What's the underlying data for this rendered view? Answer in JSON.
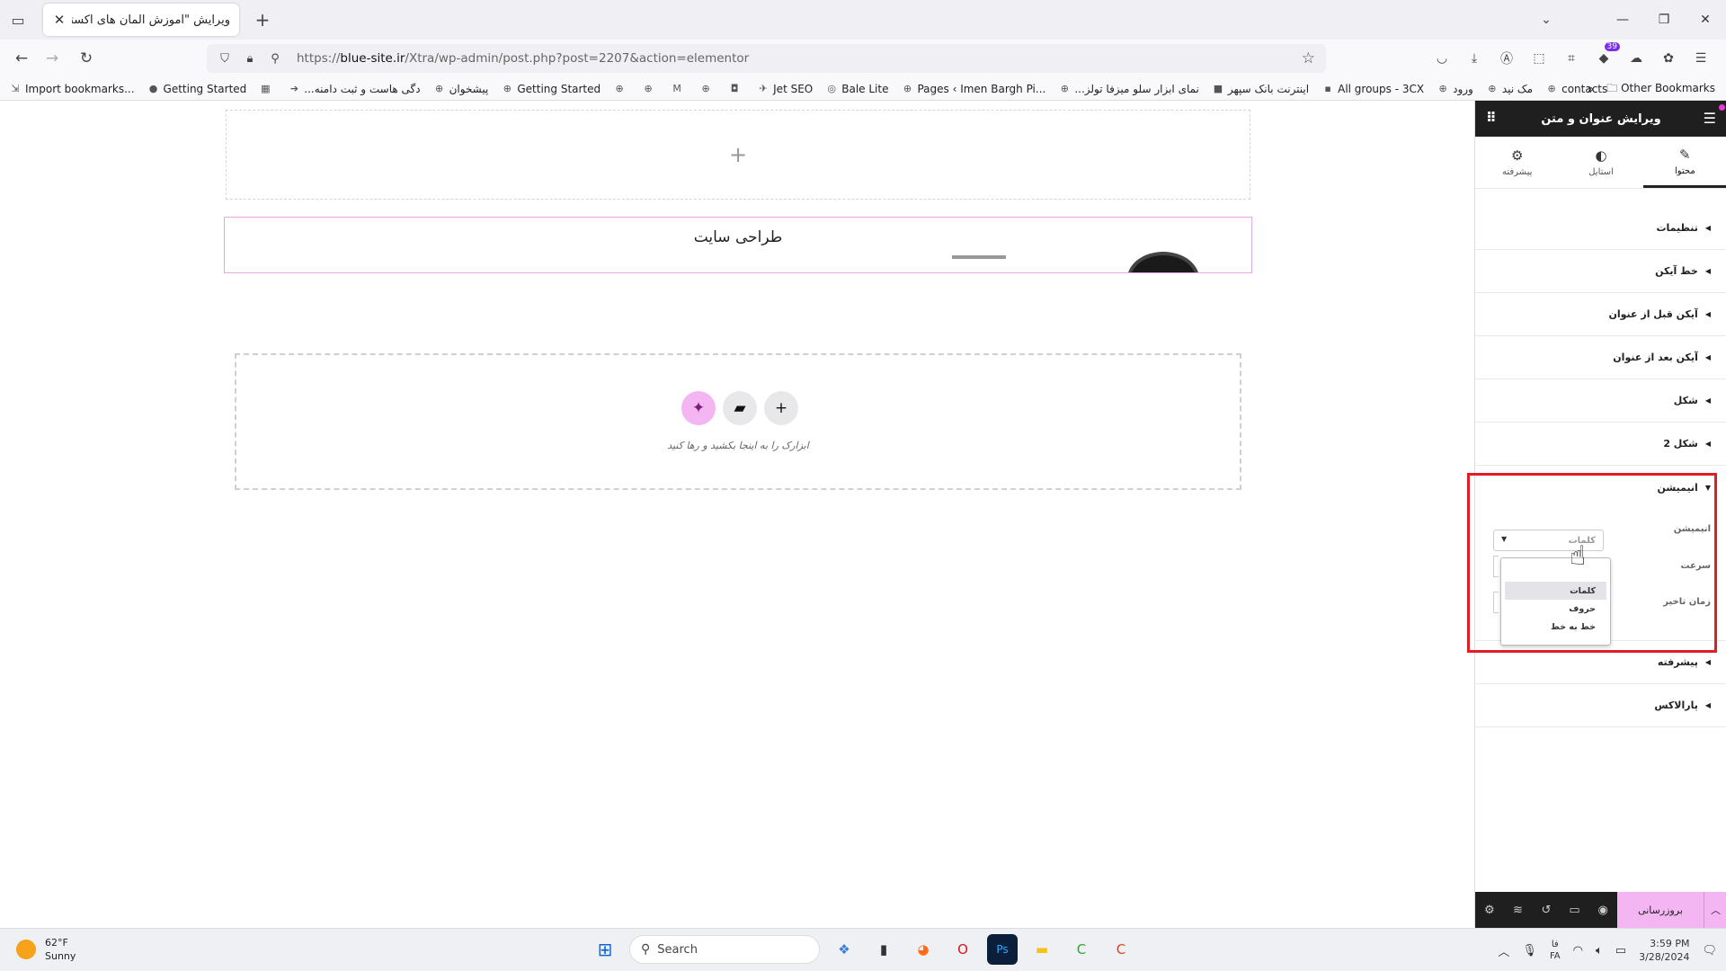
{
  "browser": {
    "tab_title": "ویرایش \"آموزش المان های اکسترا – ت",
    "url_prefix": "https://",
    "url_domain": "blue-site.ir",
    "url_path": "/Xtra/wp-admin/post.php?post=2207&action=elementor",
    "extensions_badge": "39"
  },
  "bookmarks": {
    "items": [
      {
        "label": "Import bookmarks...",
        "icon": "import-icon"
      },
      {
        "label": "Getting Started",
        "icon": "firefox-icon"
      },
      {
        "label": "",
        "icon": "calendar-icon"
      },
      {
        "label": "...دگی هاست و ثبت دامنه",
        "icon": "arrow-icon"
      },
      {
        "label": "پیشخوان",
        "icon": "globe-icon"
      },
      {
        "label": "Getting Started",
        "icon": "globe-icon"
      },
      {
        "label": "",
        "icon": "globe-icon"
      },
      {
        "label": "",
        "icon": "globe-icon"
      },
      {
        "label": "",
        "icon": "gmail-icon"
      },
      {
        "label": "",
        "icon": "globe-icon"
      },
      {
        "label": "",
        "icon": "shield-icon"
      },
      {
        "label": "Jet SEO",
        "icon": "rocket-icon"
      },
      {
        "label": "Bale Lite",
        "icon": "bale-icon"
      },
      {
        "label": "Pages ‹ Imen Bargh Pi...",
        "icon": "globe-icon"
      },
      {
        "label": "...نمای ابزار سلو میزفا تولز",
        "icon": "globe-icon"
      },
      {
        "label": "اینترنت بانک سپهر",
        "icon": "bank-icon"
      },
      {
        "label": "All groups - 3CX",
        "icon": "3cx-icon"
      },
      {
        "label": "ورود",
        "icon": "globe-icon"
      },
      {
        "label": "مک نید",
        "icon": "globe-icon"
      },
      {
        "label": "contacts",
        "icon": "globe-icon"
      }
    ],
    "other": "Other Bookmarks"
  },
  "canvas": {
    "heading_text": "طراحی سایت",
    "drop_zone_text": "ابزارک را به اینجا بکشید و رها کنید"
  },
  "panel": {
    "title": "ویرایش عنوان و متن",
    "tabs": [
      {
        "label": "محتوا",
        "icon": "pencil-icon"
      },
      {
        "label": "استایل",
        "icon": "contrast-icon"
      },
      {
        "label": "پیشرفته",
        "icon": "gear-icon"
      }
    ],
    "sections_top": [
      "تنظیمات",
      "خط آیکن",
      "آیکن قبل از عنوان",
      "آیکن بعد از عنوان",
      "شکل",
      "شکل 2"
    ],
    "animation": {
      "header": "انیمیشن",
      "field_label": "انیمیشن",
      "selected_value": "کلمات",
      "speed_label": "سرعت",
      "delay_label": "زمان تاخیر",
      "options": [
        "کلمات",
        "حروف",
        "خط به خط"
      ]
    },
    "sections_bottom": [
      "پیشرفته",
      "پارالاکس"
    ],
    "update_label": "بروزرسانی"
  },
  "taskbar": {
    "temperature": "62°F",
    "weather": "Sunny",
    "search_placeholder": "Search",
    "lang_top": "فا",
    "lang_bottom": "FA",
    "time": "3:59 PM",
    "date": "3/28/2024"
  }
}
